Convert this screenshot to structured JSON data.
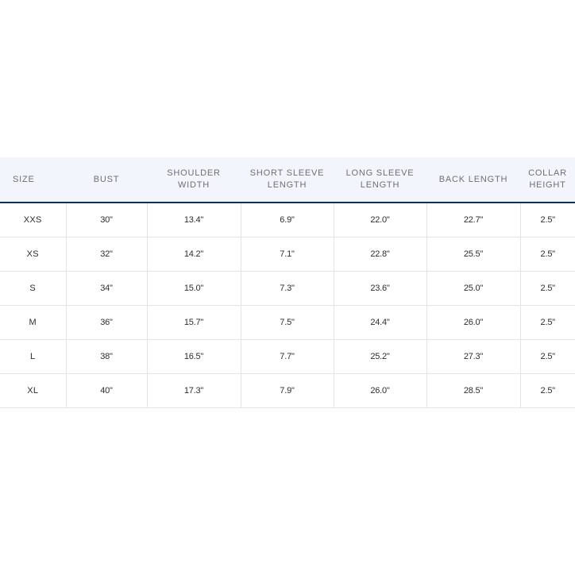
{
  "table": {
    "headers": [
      "SIZE",
      "BUST",
      "SHOULDER WIDTH",
      "SHORT SLEEVE LENGTH",
      "LONG SLEEVE LENGTH",
      "BACK LENGTH",
      "COLLAR HEIGHT"
    ],
    "rows": [
      [
        "XXS",
        "30\"",
        "13.4\"",
        "6.9\"",
        "22.0\"",
        "22.7\"",
        "2.5\""
      ],
      [
        "XS",
        "32\"",
        "14.2\"",
        "7.1\"",
        "22.8\"",
        "25.5\"",
        "2.5\""
      ],
      [
        "S",
        "34\"",
        "15.0\"",
        "7.3\"",
        "23.6\"",
        "25.0\"",
        "2.5\""
      ],
      [
        "M",
        "36\"",
        "15.7\"",
        "7.5\"",
        "24.4\"",
        "26.0\"",
        "2.5\""
      ],
      [
        "L",
        "38\"",
        "16.5\"",
        "7.7\"",
        "25.2\"",
        "27.3\"",
        "2.5\""
      ],
      [
        "XL",
        "40\"",
        "17.3\"",
        "7.9\"",
        "26.0\"",
        "28.5\"",
        "2.5\""
      ]
    ]
  },
  "colors": {
    "header_background": "#f2f6fc",
    "header_rule": "#0f2f5f",
    "grid_line": "#e4e4e4",
    "header_text": "#6f6f6f",
    "cell_text": "#2d2d2d"
  }
}
